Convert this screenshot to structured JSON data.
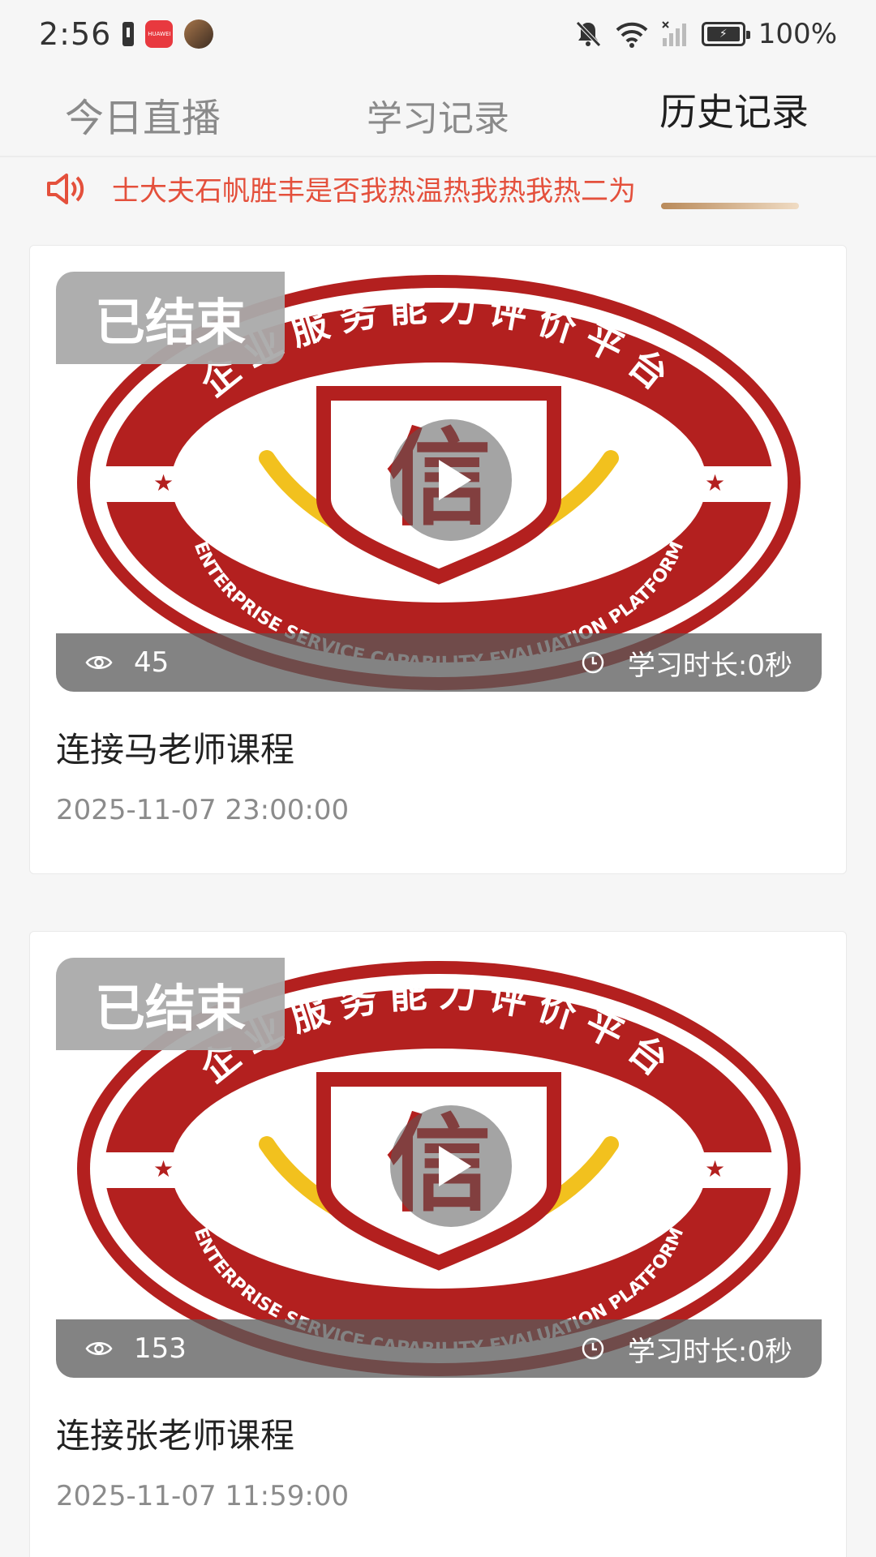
{
  "status_bar": {
    "time": "2:56",
    "battery": "100%",
    "app_icon_label": "HUAWEI"
  },
  "tabs": [
    {
      "label": "今日直播",
      "active": false
    },
    {
      "label": "学习记录",
      "active": false
    },
    {
      "label": "历史记录",
      "active": true
    }
  ],
  "notice": {
    "text": "士大夫石帆胜丰是否我热温热我热我热二为"
  },
  "logo": {
    "arc_text": "企业服务能力评价平台",
    "arc_text_en": "ENTERPRISE SERVICE CAPABILITY EVALUATION PLATFORM",
    "center_char": "信",
    "colors": {
      "red": "#b3201f",
      "gold": "#f2c11e"
    }
  },
  "courses": [
    {
      "status": "已结束",
      "views": "45",
      "duration": "学习时长:0秒",
      "title": "连接马老师课程",
      "date": "2025-11-07 23:00:00"
    },
    {
      "status": "已结束",
      "views": "153",
      "duration": "学习时长:0秒",
      "title": "连接张老师课程",
      "date": "2025-11-07 11:59:00"
    }
  ],
  "colors": {
    "accent": "#e4503c",
    "tab_underline": "#c89564"
  }
}
